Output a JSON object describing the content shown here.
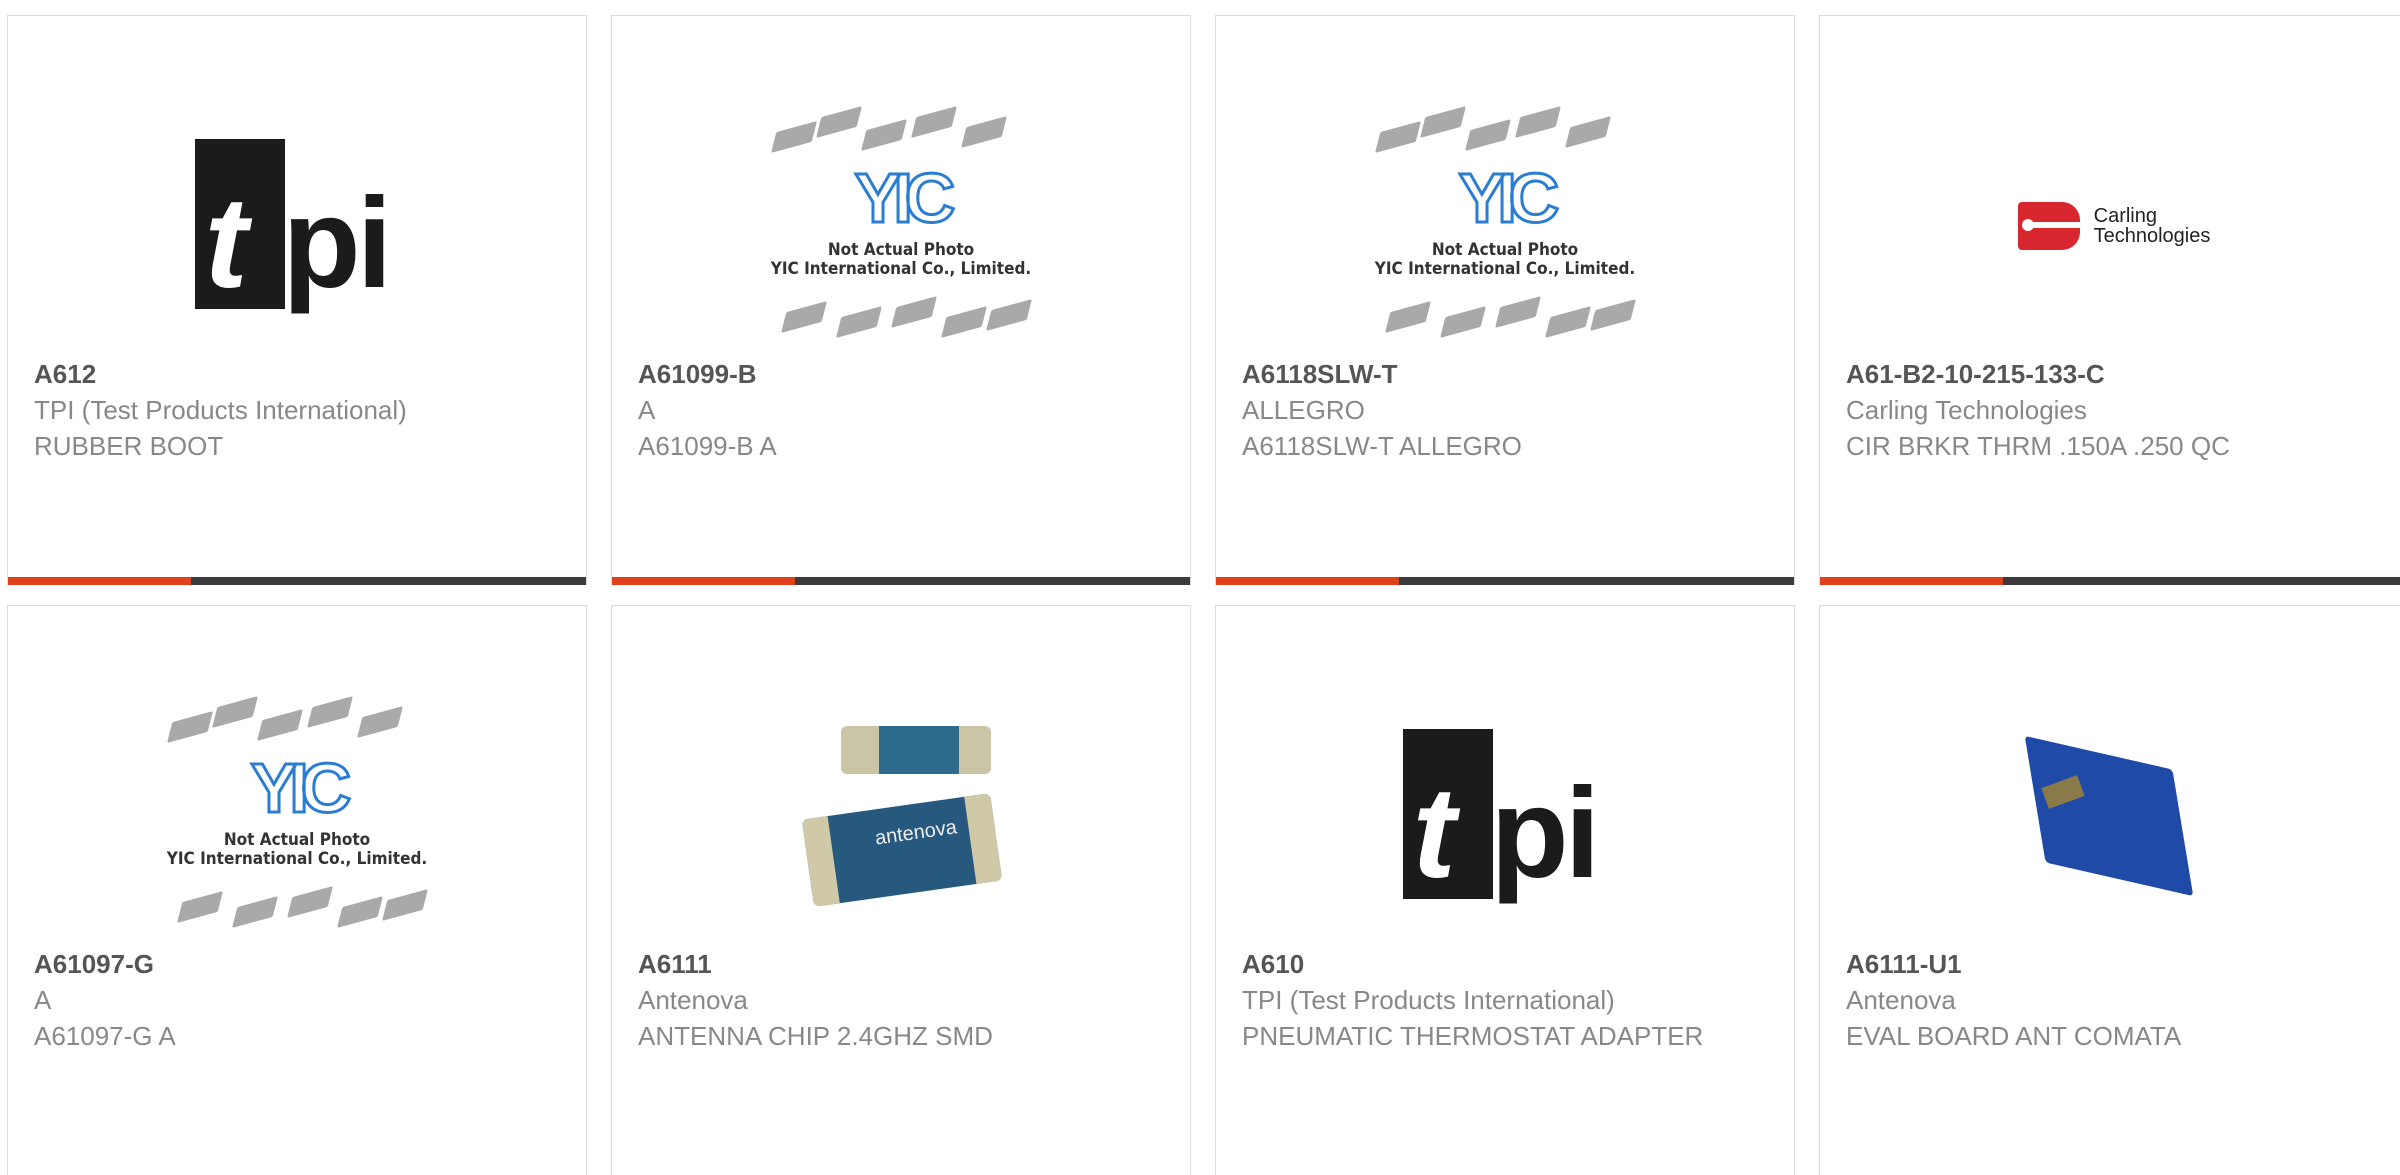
{
  "products": [
    {
      "part_number": "A612",
      "manufacturer": "TPI (Test Products International)",
      "description": "RUBBER BOOT",
      "image": "tpi-logo"
    },
    {
      "part_number": "A61099-B",
      "manufacturer": "A",
      "description": "A61099-B A",
      "image": "yic-placeholder"
    },
    {
      "part_number": "A6118SLW-T",
      "manufacturer": "ALLEGRO",
      "description": "A6118SLW-T ALLEGRO",
      "image": "yic-placeholder"
    },
    {
      "part_number": "A61-B2-10-215-133-C",
      "manufacturer": "Carling Technologies",
      "description": "CIR BRKR THRM .150A .250 QC",
      "image": "carling-logo"
    },
    {
      "part_number": "A61097-G",
      "manufacturer": "A",
      "description": "A61097-G A",
      "image": "yic-placeholder"
    },
    {
      "part_number": "A6111",
      "manufacturer": "Antenova",
      "description": "ANTENNA CHIP 2.4GHZ SMD",
      "image": "antenova-chip"
    },
    {
      "part_number": "A610",
      "manufacturer": "TPI (Test Products International)",
      "description": "PNEUMATIC THERMOSTAT ADAPTER",
      "image": "tpi-logo"
    },
    {
      "part_number": "A6111-U1",
      "manufacturer": "Antenova",
      "description": "EVAL BOARD ANT COMATA",
      "image": "eval-board"
    }
  ],
  "logos": {
    "tpi_t": "t",
    "tpi_pi": "pi",
    "yic_mark": "YIC",
    "yic_caption_1": "Not Actual Photo",
    "yic_caption_2": "YIC International Co., Limited.",
    "carling_1": "Carling",
    "carling_2": "Technologies",
    "antenova_label": "antenova"
  },
  "colors": {
    "accent": "#e0401c",
    "bar": "#3b3b3b",
    "title": "#555555",
    "body": "#888888"
  }
}
